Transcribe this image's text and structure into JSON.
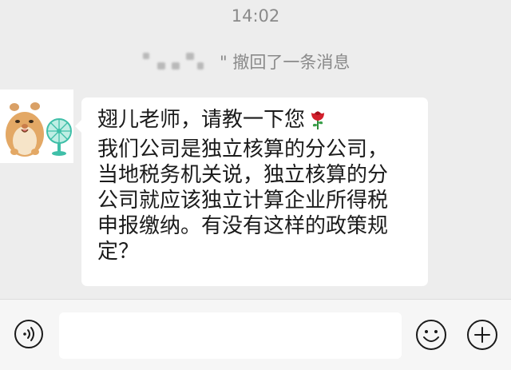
{
  "chat": {
    "timestamp": "14:02",
    "recall_notice": "\" 撤回了一条消息",
    "message": {
      "lines": [
        "翅儿老师，请教一下您",
        "我们公司是独立核算的分公司，",
        "当地税务机关说，独立核算的分",
        "公司就应该独立计算企业所得税",
        "申报缴纳。有没有这样的政策规",
        "定？"
      ],
      "emoji": "rose-icon"
    }
  },
  "input_bar": {
    "voice_icon": "voice-icon",
    "emoji_icon": "emoji-icon",
    "plus_icon": "plus-icon",
    "input_value": ""
  },
  "colors": {
    "background": "#ededed",
    "bubble": "#ffffff",
    "timestamp_text": "#8a8a8a",
    "message_text": "#1b1b1b"
  }
}
